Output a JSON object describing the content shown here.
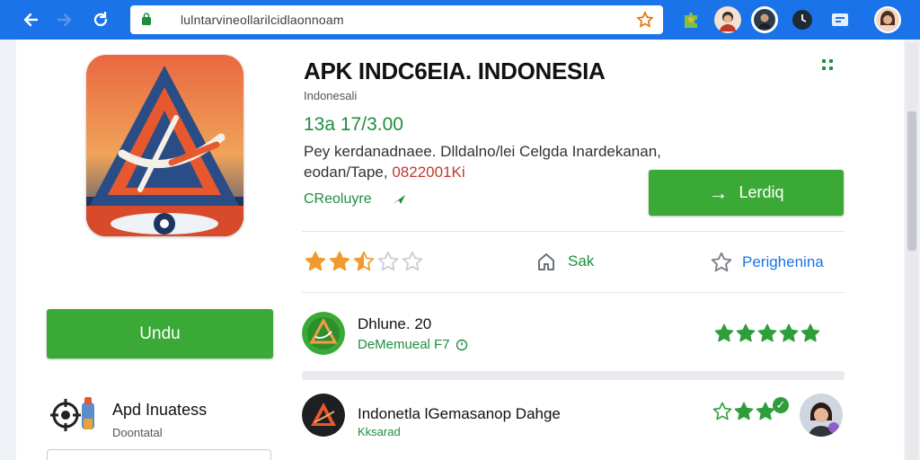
{
  "browser": {
    "url": "lulntarvineollarilcidlaonnoam",
    "back_label": "←",
    "forward_label": "→",
    "reload_label": "↻"
  },
  "app": {
    "title": "APK INDC6EIA. INDONESIA",
    "subtitle": "Indonesali",
    "price": "13a 17/3.00",
    "description_line1": "Pey kerdanadnaee. Dlldalno/lei Celgda Inardekanan,",
    "description_line2_prefix": "eodan/Tape,",
    "description_line2_highlight": "0822001Ki",
    "category": "CReoluyre",
    "install_label": "Lerdiq",
    "install_arrow": "→",
    "rating_stars": 2.5,
    "share_label": "Sak",
    "wishlist_label": "Perighenina"
  },
  "download_button": {
    "label": "Undu"
  },
  "related": [
    {
      "title": "Dhlune. 20",
      "subtitle": "DeMemueal F7",
      "stars": 5
    },
    {
      "title": "Indonetla lGemasanop Dahge",
      "subtitle": "Kksarad",
      "stars": 3
    }
  ],
  "sidebar": {
    "app_title": "Apd Inuatess",
    "app_sub": "Doontatal"
  },
  "colors": {
    "accent_blue": "#1a73e8",
    "green": "#3aa935",
    "star_orange": "#f29a2e",
    "star_green": "#2e9e3a"
  }
}
